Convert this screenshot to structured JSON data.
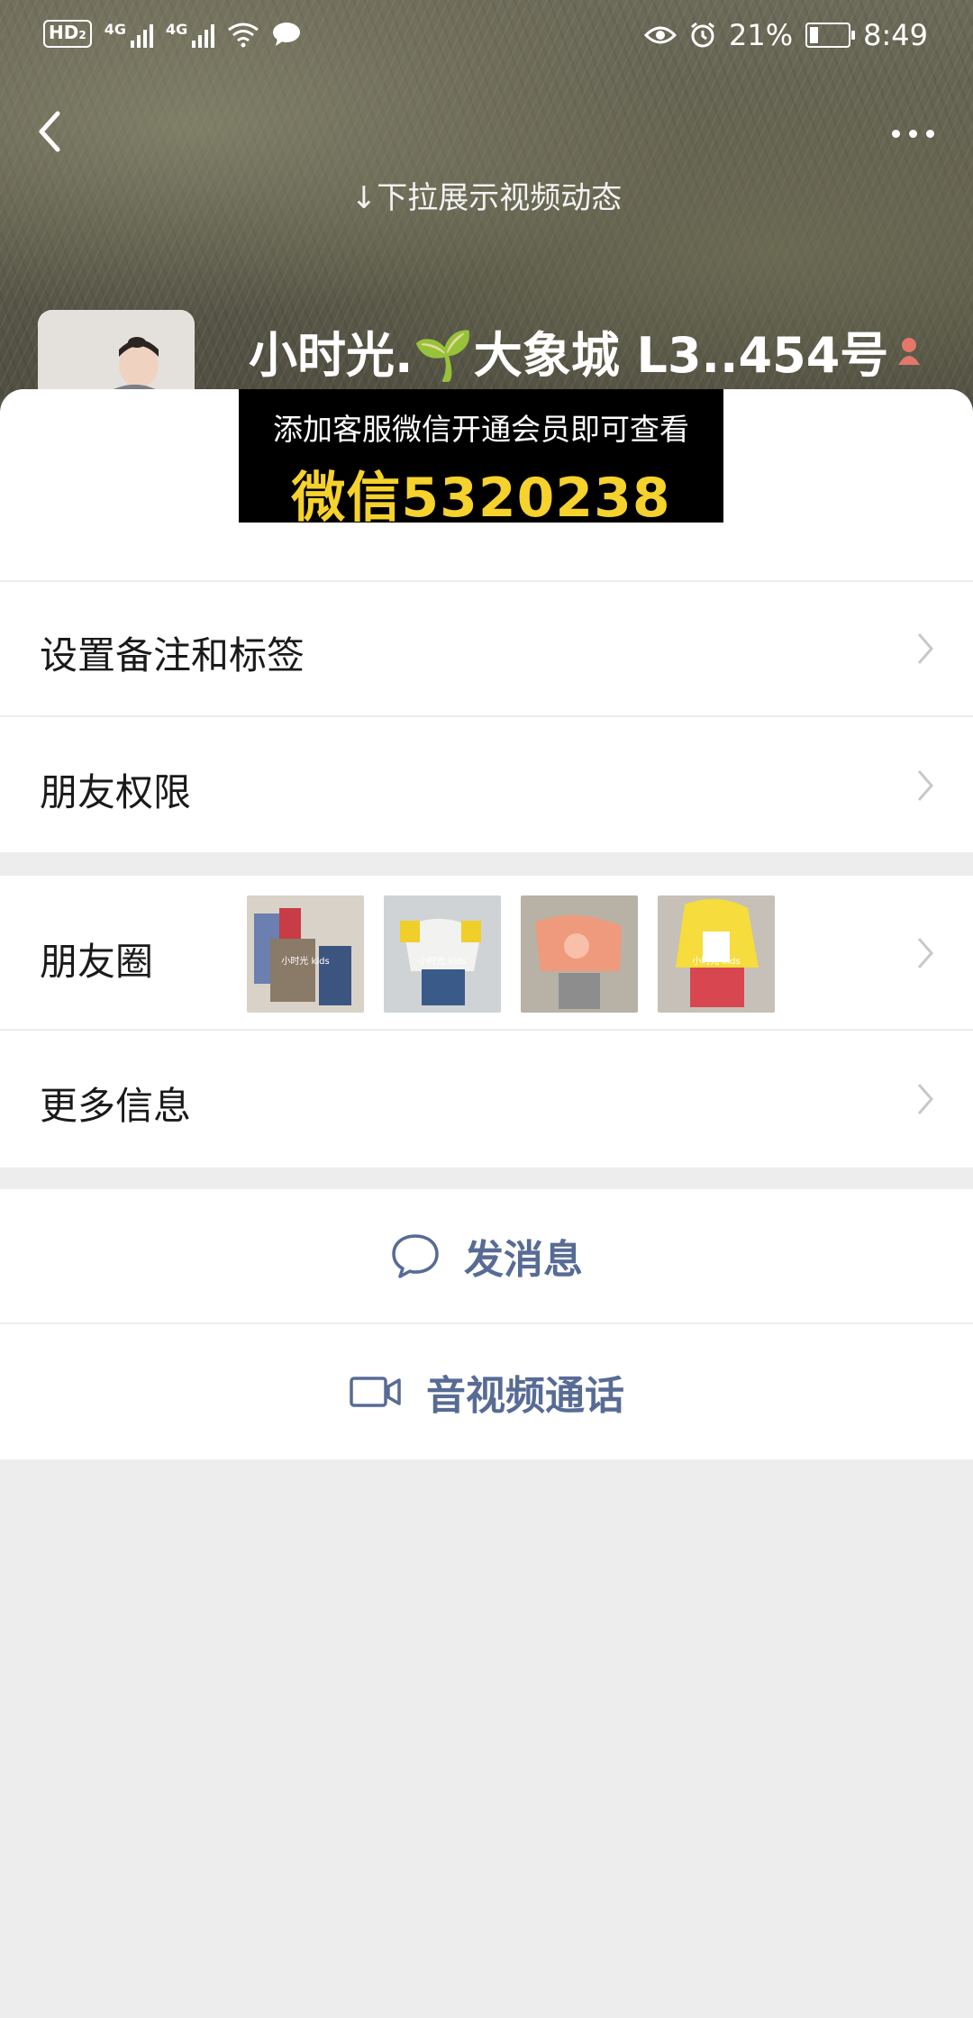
{
  "status_bar": {
    "hd_label": "HD",
    "hd_sub": "2",
    "network_1": "4G",
    "network_2": "4G",
    "battery_percent": "21%",
    "time": "8:49"
  },
  "header": {
    "pull_hint": "↓下拉展示视频动态",
    "nickname": "小时光.🌱大象城 L3..454号"
  },
  "banner": {
    "line1": "添加客服微信开通会员即可查看",
    "line2": "微信5320238"
  },
  "menu": {
    "remark_label": "设置备注和标签",
    "permission_label": "朋友权限",
    "moments_label": "朋友圈",
    "more_info_label": "更多信息"
  },
  "moments_thumbs": [
    {
      "caption": "小时光 kids"
    },
    {
      "caption": "小时光 kids"
    },
    {
      "caption": ""
    },
    {
      "caption": "小时光 kids"
    }
  ],
  "actions": {
    "message_label": "发消息",
    "call_label": "音视频通话"
  },
  "colors": {
    "link_blue": "#576b95",
    "banner_yellow": "#f5d22c",
    "page_gray": "#ededed"
  },
  "icons": {
    "back": "chevron-left-icon",
    "more": "more-dots-icon",
    "message": "chat-bubble-icon",
    "video": "video-camera-icon"
  }
}
